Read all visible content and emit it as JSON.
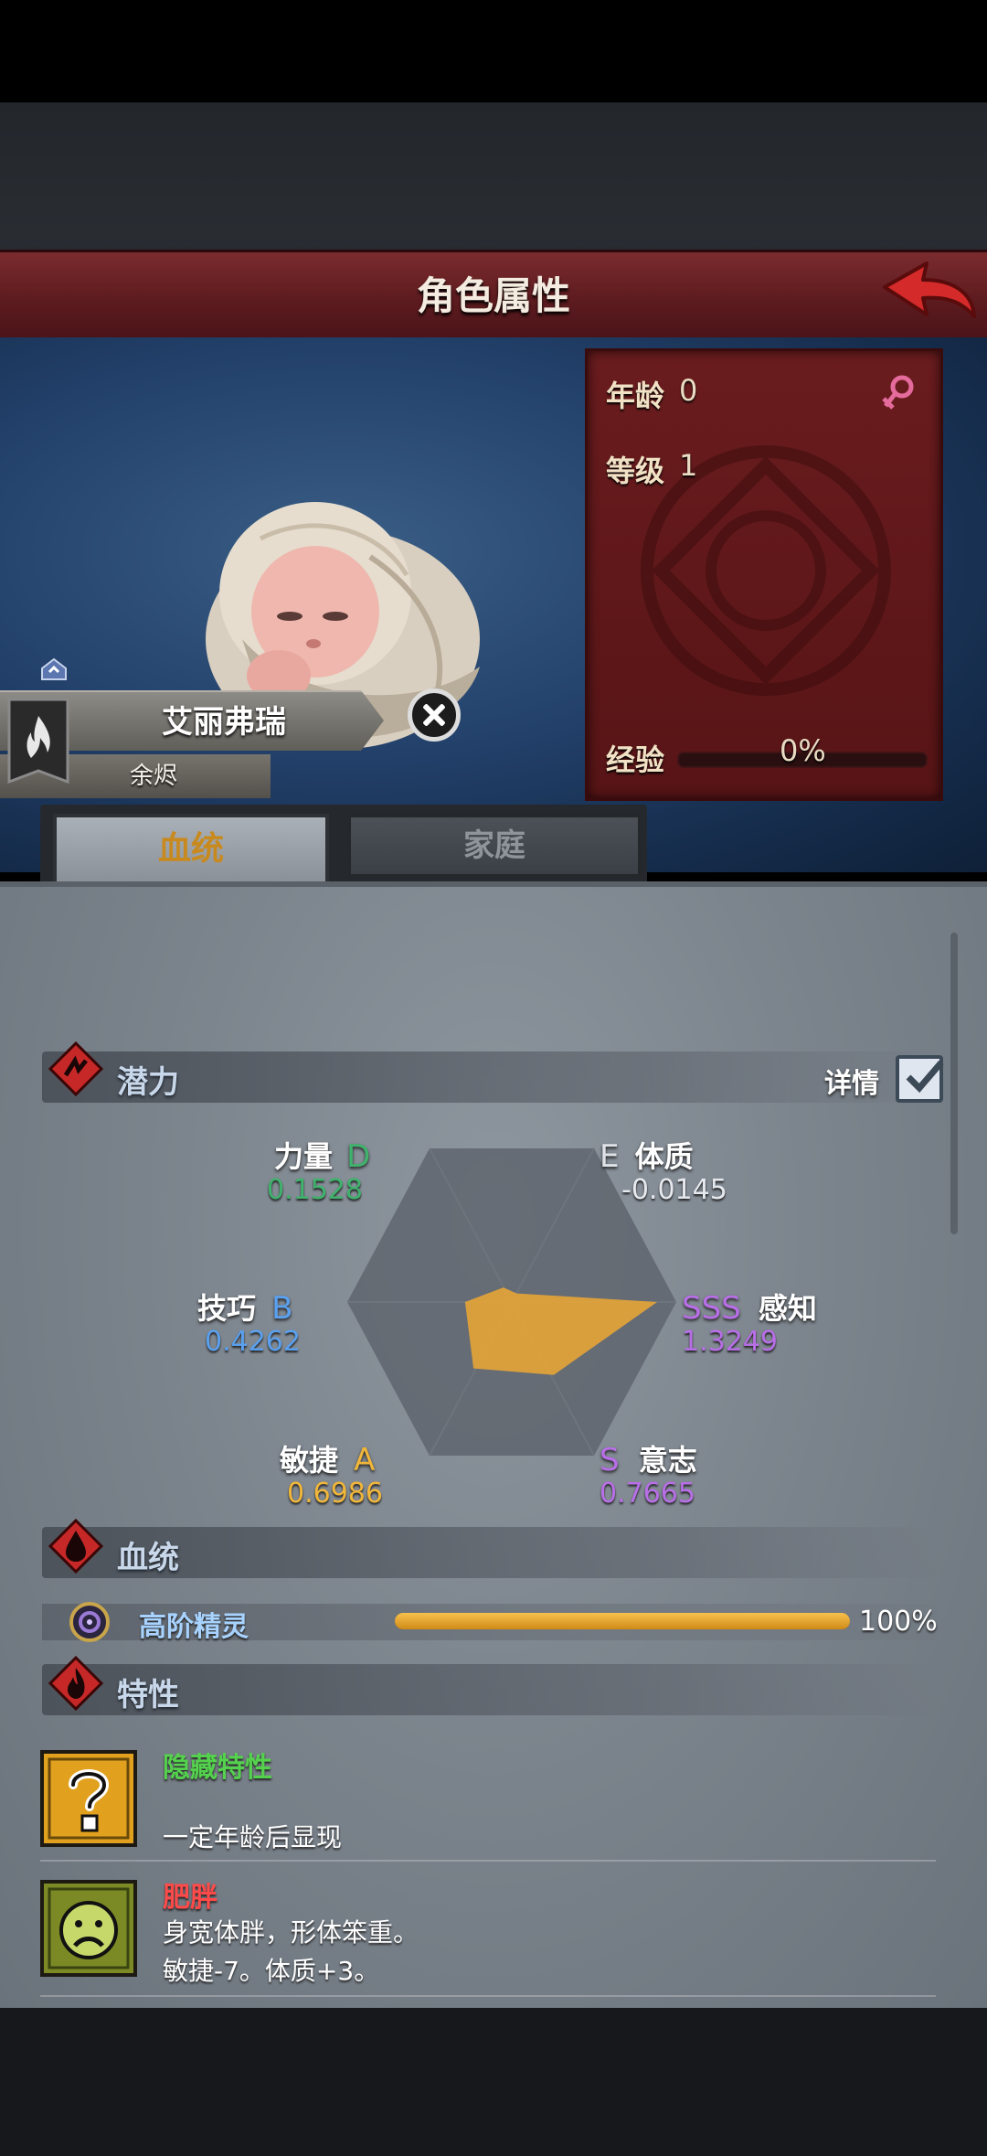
{
  "header": {
    "title": "角色属性"
  },
  "character": {
    "name": "艾丽弗瑞",
    "title": "余烬",
    "age_label": "年龄",
    "age": "0",
    "level_label": "等级",
    "level": "1",
    "exp_label": "经验",
    "exp": "0%",
    "exp_fraction": 0.0
  },
  "tabs": [
    {
      "label": "血统",
      "active": true
    },
    {
      "label": "家庭",
      "active": false
    }
  ],
  "potential": {
    "title": "潜力",
    "detail_label": "详情",
    "detail_checked": true,
    "attributes": [
      {
        "name": "力量",
        "grade": "D",
        "value": "0.1528",
        "color": "#3fb36c"
      },
      {
        "name": "体质",
        "grade": "E",
        "value": "-0.0145",
        "color": "#dfe3e8"
      },
      {
        "name": "感知",
        "grade": "SSS",
        "value": "1.3249",
        "color": "#b86ee6"
      },
      {
        "name": "意志",
        "grade": "S",
        "value": "0.7665",
        "color": "#b86ee6"
      },
      {
        "name": "敏捷",
        "grade": "A",
        "value": "0.6986",
        "color": "#f0b63a"
      },
      {
        "name": "技巧",
        "grade": "B",
        "value": "0.4262",
        "color": "#5aa0ee"
      }
    ]
  },
  "bloodline": {
    "title": "血统",
    "items": [
      {
        "name": "高阶精灵",
        "percent_text": "100%",
        "fraction": 1.0
      }
    ]
  },
  "traits": {
    "title": "特性",
    "items": [
      {
        "name": "隐藏特性",
        "name_color": "#54d24d",
        "lines": [
          "一定年龄后显现"
        ],
        "icon": "question-icon"
      },
      {
        "name": "肥胖",
        "name_color": "#ff4a4a",
        "lines": [
          "身宽体胖，形体笨重。",
          "敏捷-7。体质+3。"
        ],
        "icon": "sad-face-icon"
      }
    ]
  },
  "colors": {
    "accent": "#c88a1e",
    "radar_fill": "#e0a23a",
    "header_red": "#6a2226"
  }
}
